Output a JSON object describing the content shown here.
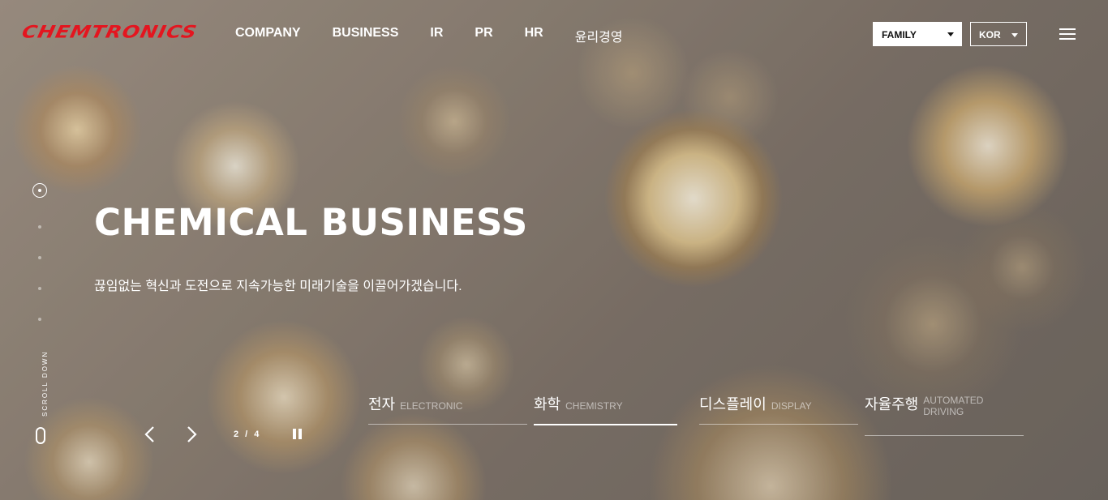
{
  "header": {
    "logo": "CHEMTRONICS",
    "nav": [
      "COMPANY",
      "BUSINESS",
      "IR",
      "PR",
      "HR",
      "윤리경영"
    ],
    "family_select": "FAMILY",
    "lang_select": "KOR",
    "brand_color": "#e4151f"
  },
  "hero": {
    "title": "CHEMICAL BUSINESS",
    "subtitle": "끊임없는 혁신과 도전으로 지속가능한 미래기술을 이끌어가겠습니다."
  },
  "side": {
    "scroll_label": "SCROLL DOWN",
    "dots": 5,
    "active_dot": 1
  },
  "slider": {
    "current": "2",
    "separator": "/",
    "total": "4"
  },
  "tabs": [
    {
      "ko": "전자",
      "en": "ELECTRONIC"
    },
    {
      "ko": "화학",
      "en": "CHEMISTRY"
    },
    {
      "ko": "디스플레이",
      "en": "DISPLAY"
    },
    {
      "ko": "자율주행",
      "en": "AUTOMATED DRIVING"
    }
  ]
}
